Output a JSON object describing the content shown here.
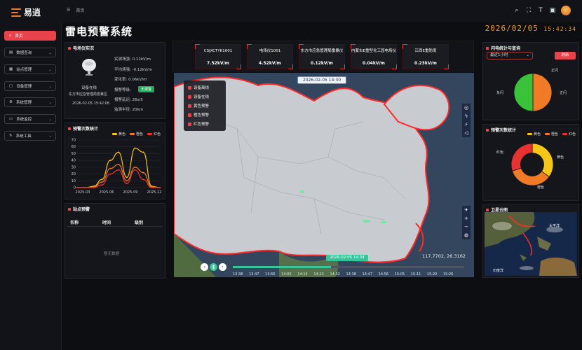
{
  "app": {
    "logo_text": "易逍",
    "breadcrumb": "首页"
  },
  "header": {
    "title": "雷电预警系统",
    "date": "2026/02/05",
    "time": "15:42:34"
  },
  "sidebar": {
    "items": [
      {
        "label": "首页",
        "active": true,
        "icon": "home-icon"
      },
      {
        "label": "数据查询",
        "icon": "document-icon"
      },
      {
        "label": "站点管理",
        "icon": "list-icon"
      },
      {
        "label": "设备管理",
        "icon": "device-icon"
      },
      {
        "label": "系统管理",
        "icon": "gear-icon"
      },
      {
        "label": "系统监控",
        "icon": "monitor-icon"
      },
      {
        "label": "系统工具",
        "icon": "tool-icon"
      }
    ]
  },
  "device_panel": {
    "title": "电场仪实况",
    "status": "设备在线",
    "station": "东方市应急管理局雷暴区",
    "timestamp": "2026-02-05 15:42:08",
    "rows": [
      {
        "label": "实测场强:",
        "value": "0.12kV/m"
      },
      {
        "label": "平均场强:",
        "value": "-0.12kV/m"
      },
      {
        "label": "变化率:",
        "value": "0.06kV/m"
      },
      {
        "label": "报警等级:",
        "value": "无报警"
      },
      {
        "label": "报警延迟:",
        "value": "26s/5"
      },
      {
        "label": "监测半径:",
        "value": "20km"
      }
    ]
  },
  "field_cards": [
    {
      "name": "CSJXCTYK1001",
      "value": "7.52kV/m"
    },
    {
      "name": "电场仪1001",
      "value": "4.52kV/m"
    },
    {
      "name": "东方市应急管理局雷暴仪",
      "value": "0.12kV/m"
    },
    {
      "name": "内蒙古E重型化工园电场仪",
      "value": "0.04kV/m"
    },
    {
      "name": "江西E重防雨",
      "value": "0.23kV/m"
    }
  ],
  "warning_chart": {
    "title": "预警次数统计",
    "legend": [
      "黄色",
      "橙色",
      "红色"
    ],
    "colors": [
      "#f5c518",
      "#f07a26",
      "#e83232"
    ],
    "chart_data": {
      "type": "line",
      "categories": [
        "2025-03",
        "2025-06",
        "2025-09",
        "2025-12"
      ],
      "series": [
        {
          "name": "黄色",
          "values": [
            0,
            0,
            2,
            12,
            40,
            52,
            15,
            58,
            52,
            2,
            0
          ]
        },
        {
          "name": "橙色",
          "values": [
            0,
            0,
            1,
            8,
            28,
            34,
            10,
            30,
            22,
            1,
            0
          ]
        },
        {
          "name": "红色",
          "values": [
            0,
            0,
            0,
            4,
            20,
            26,
            6,
            26,
            12,
            0,
            0
          ]
        }
      ],
      "ylim": [
        0,
        70
      ],
      "yticks": [
        0,
        10,
        20,
        30,
        40,
        50,
        60,
        70
      ]
    }
  },
  "station_warning": {
    "title": "站点预警",
    "columns": [
      "名称",
      "时间",
      "级别"
    ],
    "empty_text": "暂无数据"
  },
  "map": {
    "date_label": "2026-02-05 14:30",
    "layers": [
      "设备离线",
      "设备在线",
      "黄色预警",
      "橙色预警",
      "红色预警"
    ],
    "coords": "117.7702, 26.3162",
    "current_time": "2026-02-05 14:34",
    "ticks": [
      "13:38",
      "13:47",
      "13:56",
      "14:05",
      "14:14",
      "14:23",
      "14:32",
      "14:38",
      "14:47",
      "14:56",
      "15:05",
      "15:11",
      "15:20",
      "15:26"
    ]
  },
  "lightning_stats": {
    "title": "闪电统计与查询",
    "range": "最近1小时",
    "refresh_label": "刷新",
    "labels": {
      "positive": "正闪",
      "negative": "负闪"
    },
    "chart_data": {
      "type": "pie",
      "labels": [
        "正闪",
        "负闪"
      ],
      "values": [
        50,
        50
      ],
      "colors": [
        "#f07a26",
        "#3ac23a"
      ]
    }
  },
  "warning_pie": {
    "title": "预警次数统计",
    "legend": [
      "黄色",
      "橙色",
      "红色"
    ],
    "chart_data": {
      "type": "pie",
      "labels": [
        "黄色",
        "橙色",
        "红色"
      ],
      "values": [
        35,
        35,
        30
      ],
      "colors": [
        "#f5c518",
        "#f07a26",
        "#e83232"
      ]
    }
  },
  "satellite": {
    "title": "卫星云图",
    "labels": [
      "太平洋",
      "印度洋"
    ]
  }
}
